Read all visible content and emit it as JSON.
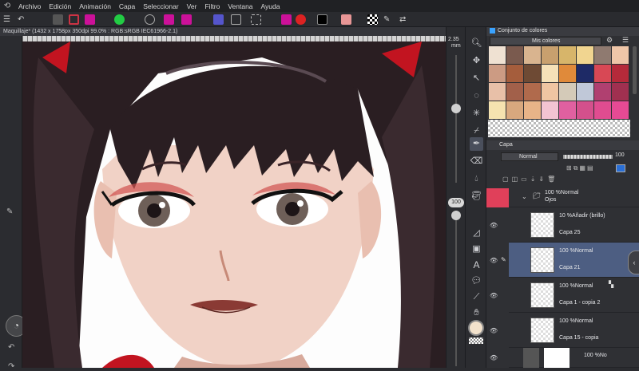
{
  "menu": {
    "items": [
      "Archivo",
      "Edición",
      "Animación",
      "Capa",
      "Seleccionar",
      "Ver",
      "Filtro",
      "Ventana",
      "Ayuda"
    ]
  },
  "canvas_tab": {
    "title": "Maquillaje* (1432 x 1758px 350dpi 99.0% : RGB:sRGB IEC61966-2.1)"
  },
  "brush_size": {
    "value": "2.35",
    "unit": "mm"
  },
  "opacity_slider": {
    "value": "100",
    "level": 1.0
  },
  "color_set": {
    "panel_title": "Conjunto de colores",
    "set_name": "Mis colores",
    "colors": [
      "#efe1d2",
      "#7a5a4e",
      "#d9b48f",
      "#c8a06e",
      "#d7b56a",
      "#f1d590",
      "#8f7a70",
      "#efc6a8",
      "#cc9b83",
      "#a55d3c",
      "#6e4a34",
      "#f5e1b8",
      "#e08a3a",
      "#1e2a66",
      "#d84855",
      "#b52a3a",
      "#e8c0a8",
      "#a2604a",
      "#b06a4c",
      "#efc5a2",
      "#d4cab8",
      "#c0c8d8",
      "#b04070",
      "#a03050",
      "#f5e3b0",
      "#d8a87e",
      "#e8b488",
      "#f2c4d2",
      "#e060a0",
      "#d4508c",
      "#e04c90",
      "#e64a94"
    ]
  },
  "layer_panel": {
    "tab_label": "Capa",
    "blend_mode": "Normal",
    "opacity": "100",
    "folder": {
      "mode": "100 %Normal",
      "name": "Ojos"
    },
    "layers": [
      {
        "mode": "10 %Añadir (brillo)",
        "name": "Capa 25",
        "selected": false
      },
      {
        "mode": "100 %Normal",
        "name": "Capa 21",
        "selected": true
      },
      {
        "mode": "100 %Normal",
        "name": "Capa 1 - copia 2",
        "selected": false
      },
      {
        "mode": "100 %Normal",
        "name": "Capa 15 - copia",
        "selected": false
      },
      {
        "mode": "100 %No",
        "name": "",
        "selected": false
      }
    ]
  },
  "colors": {
    "accent_selected": "#4d5e82",
    "toggle_red": "#e0405a",
    "ui_bg": "#2b2c30"
  }
}
